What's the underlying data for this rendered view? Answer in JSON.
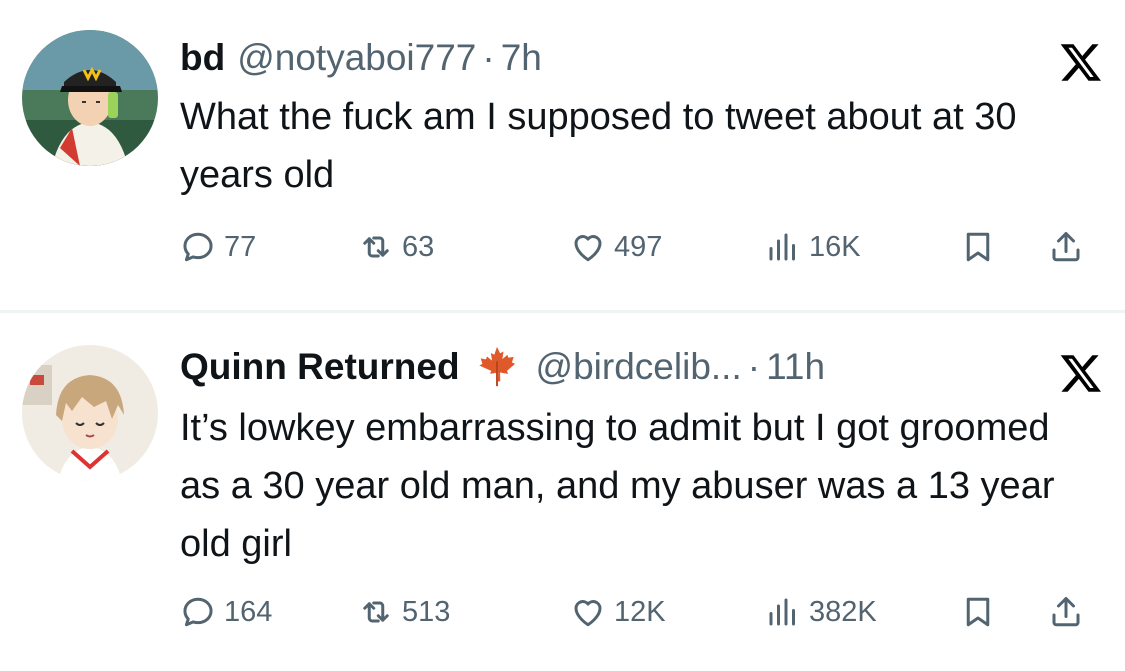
{
  "colors": {
    "text": "#0f1419",
    "secondary": "#536471",
    "divider": "#eff3f4"
  },
  "tweets": [
    {
      "author": {
        "display_name": "bd",
        "handle": "@notyaboi777",
        "avatar_icon": "avatar-image"
      },
      "separator": "·",
      "time": "7h",
      "text": "What the fuck am I supposed to tweet about at 30 years old",
      "stats": {
        "replies": "77",
        "retweets": "63",
        "likes": "497",
        "views": "16K"
      }
    },
    {
      "author": {
        "display_name": "Quinn Returned",
        "badge_icon": "maple-leaf-icon",
        "handle": "@birdcelib...",
        "avatar_icon": "avatar-image"
      },
      "separator": "·",
      "time": "11h",
      "text": "It’s lowkey embarrassing to admit but I got groomed as a 30 year old man, and my abuser was a 13 year old girl",
      "stats": {
        "replies": "164",
        "retweets": "513",
        "likes": "12K",
        "views": "382K"
      }
    }
  ]
}
